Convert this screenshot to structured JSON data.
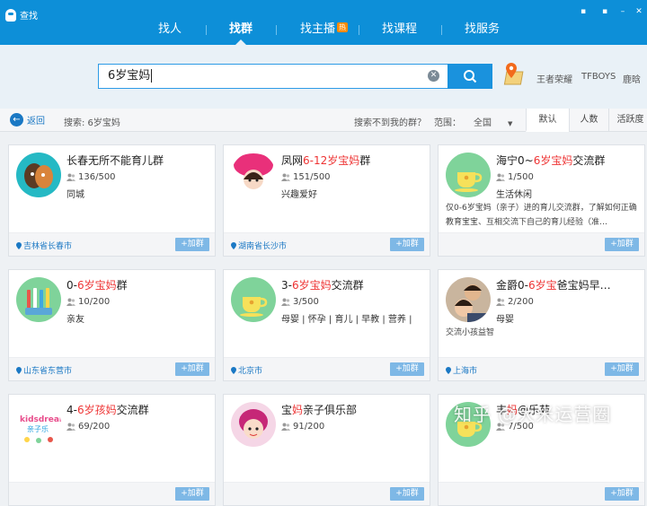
{
  "window": {
    "title": "查找"
  },
  "nav": {
    "tabs": [
      {
        "label": "找人"
      },
      {
        "label": "找群"
      },
      {
        "label": "找主播",
        "badge": "热"
      },
      {
        "label": "找课程"
      },
      {
        "label": "找服务"
      }
    ],
    "active_index": 1
  },
  "search": {
    "value": "6岁宝妈",
    "hot_keywords": [
      "王者荣耀",
      "TFBOYS",
      "鹿晗"
    ]
  },
  "filter": {
    "back_label": "返回",
    "search_info": "搜索: 6岁宝妈",
    "not_found": "搜索不到我的群？",
    "range_label": "范围：",
    "range_value": "全国",
    "sort_tabs": [
      "默认",
      "人数",
      "活跃度"
    ]
  },
  "join_label": "+加群",
  "cards": [
    {
      "name_parts": [
        "长春无所不能育儿群",
        "",
        ""
      ],
      "count": "136/500",
      "tag": "同城",
      "desc": "",
      "location": "吉林省长春市"
    },
    {
      "name_parts": [
        "凤网",
        "6-12岁宝妈",
        "群"
      ],
      "count": "151/500",
      "tag": "兴趣爱好",
      "desc": "",
      "location": "湖南省长沙市"
    },
    {
      "name_parts": [
        "海宁0~",
        "6岁宝妈",
        "交流群"
      ],
      "count": "1/500",
      "tag": "生活休闲",
      "desc": "仅0-6岁宝妈（亲子）进的育儿交流群，了解如何正确教育宝宝、互相交流下自己的育儿经验（准…",
      "location": ""
    },
    {
      "name_parts": [
        "0-",
        "6岁宝妈",
        "群"
      ],
      "count": "10/200",
      "tag": "亲友",
      "desc": "",
      "location": "山东省东营市"
    },
    {
      "name_parts": [
        "3-",
        "6岁宝妈",
        "交流群"
      ],
      "count": "3/500",
      "tag": "母婴 | 怀孕 | 育儿 | 早教 | 营养 |",
      "desc": "",
      "location": "北京市"
    },
    {
      "name_parts": [
        "金爵0-",
        "6岁宝",
        "爸宝妈早…"
      ],
      "count": "2/200",
      "tag": "母婴",
      "desc": "交流小孩益智",
      "location": "上海市"
    },
    {
      "name_parts": [
        "4-",
        "6岁孩妈",
        "交流群"
      ],
      "count": "69/200",
      "tag": "",
      "desc": "",
      "location": ""
    },
    {
      "name_parts": [
        "宝",
        "妈",
        "亲子俱乐部"
      ],
      "count": "91/200",
      "tag": "",
      "desc": "",
      "location": ""
    },
    {
      "name_parts": [
        "丰",
        "妈",
        "@乐苑"
      ],
      "count": "7/500",
      "tag": "",
      "desc": "",
      "location": ""
    }
  ],
  "colors": {
    "primary": "#0d8fd8",
    "highlight": "#e33333",
    "join": "#7eb8e6"
  },
  "watermark": "知乎 @大米运营圈"
}
